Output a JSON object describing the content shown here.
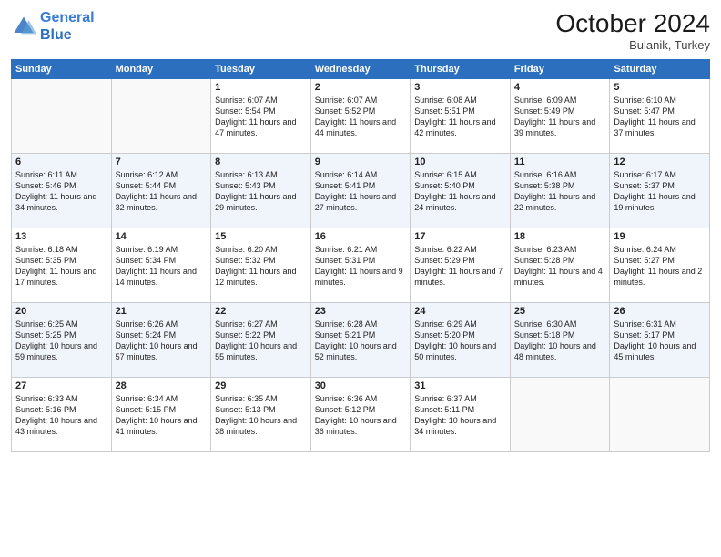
{
  "header": {
    "logo_line1": "General",
    "logo_line2": "Blue",
    "month": "October 2024",
    "location": "Bulanik, Turkey"
  },
  "days_of_week": [
    "Sunday",
    "Monday",
    "Tuesday",
    "Wednesday",
    "Thursday",
    "Friday",
    "Saturday"
  ],
  "weeks": [
    [
      {
        "day": "",
        "info": ""
      },
      {
        "day": "",
        "info": ""
      },
      {
        "day": "1",
        "info": "Sunrise: 6:07 AM\nSunset: 5:54 PM\nDaylight: 11 hours and 47 minutes."
      },
      {
        "day": "2",
        "info": "Sunrise: 6:07 AM\nSunset: 5:52 PM\nDaylight: 11 hours and 44 minutes."
      },
      {
        "day": "3",
        "info": "Sunrise: 6:08 AM\nSunset: 5:51 PM\nDaylight: 11 hours and 42 minutes."
      },
      {
        "day": "4",
        "info": "Sunrise: 6:09 AM\nSunset: 5:49 PM\nDaylight: 11 hours and 39 minutes."
      },
      {
        "day": "5",
        "info": "Sunrise: 6:10 AM\nSunset: 5:47 PM\nDaylight: 11 hours and 37 minutes."
      }
    ],
    [
      {
        "day": "6",
        "info": "Sunrise: 6:11 AM\nSunset: 5:46 PM\nDaylight: 11 hours and 34 minutes."
      },
      {
        "day": "7",
        "info": "Sunrise: 6:12 AM\nSunset: 5:44 PM\nDaylight: 11 hours and 32 minutes."
      },
      {
        "day": "8",
        "info": "Sunrise: 6:13 AM\nSunset: 5:43 PM\nDaylight: 11 hours and 29 minutes."
      },
      {
        "day": "9",
        "info": "Sunrise: 6:14 AM\nSunset: 5:41 PM\nDaylight: 11 hours and 27 minutes."
      },
      {
        "day": "10",
        "info": "Sunrise: 6:15 AM\nSunset: 5:40 PM\nDaylight: 11 hours and 24 minutes."
      },
      {
        "day": "11",
        "info": "Sunrise: 6:16 AM\nSunset: 5:38 PM\nDaylight: 11 hours and 22 minutes."
      },
      {
        "day": "12",
        "info": "Sunrise: 6:17 AM\nSunset: 5:37 PM\nDaylight: 11 hours and 19 minutes."
      }
    ],
    [
      {
        "day": "13",
        "info": "Sunrise: 6:18 AM\nSunset: 5:35 PM\nDaylight: 11 hours and 17 minutes."
      },
      {
        "day": "14",
        "info": "Sunrise: 6:19 AM\nSunset: 5:34 PM\nDaylight: 11 hours and 14 minutes."
      },
      {
        "day": "15",
        "info": "Sunrise: 6:20 AM\nSunset: 5:32 PM\nDaylight: 11 hours and 12 minutes."
      },
      {
        "day": "16",
        "info": "Sunrise: 6:21 AM\nSunset: 5:31 PM\nDaylight: 11 hours and 9 minutes."
      },
      {
        "day": "17",
        "info": "Sunrise: 6:22 AM\nSunset: 5:29 PM\nDaylight: 11 hours and 7 minutes."
      },
      {
        "day": "18",
        "info": "Sunrise: 6:23 AM\nSunset: 5:28 PM\nDaylight: 11 hours and 4 minutes."
      },
      {
        "day": "19",
        "info": "Sunrise: 6:24 AM\nSunset: 5:27 PM\nDaylight: 11 hours and 2 minutes."
      }
    ],
    [
      {
        "day": "20",
        "info": "Sunrise: 6:25 AM\nSunset: 5:25 PM\nDaylight: 10 hours and 59 minutes."
      },
      {
        "day": "21",
        "info": "Sunrise: 6:26 AM\nSunset: 5:24 PM\nDaylight: 10 hours and 57 minutes."
      },
      {
        "day": "22",
        "info": "Sunrise: 6:27 AM\nSunset: 5:22 PM\nDaylight: 10 hours and 55 minutes."
      },
      {
        "day": "23",
        "info": "Sunrise: 6:28 AM\nSunset: 5:21 PM\nDaylight: 10 hours and 52 minutes."
      },
      {
        "day": "24",
        "info": "Sunrise: 6:29 AM\nSunset: 5:20 PM\nDaylight: 10 hours and 50 minutes."
      },
      {
        "day": "25",
        "info": "Sunrise: 6:30 AM\nSunset: 5:18 PM\nDaylight: 10 hours and 48 minutes."
      },
      {
        "day": "26",
        "info": "Sunrise: 6:31 AM\nSunset: 5:17 PM\nDaylight: 10 hours and 45 minutes."
      }
    ],
    [
      {
        "day": "27",
        "info": "Sunrise: 6:33 AM\nSunset: 5:16 PM\nDaylight: 10 hours and 43 minutes."
      },
      {
        "day": "28",
        "info": "Sunrise: 6:34 AM\nSunset: 5:15 PM\nDaylight: 10 hours and 41 minutes."
      },
      {
        "day": "29",
        "info": "Sunrise: 6:35 AM\nSunset: 5:13 PM\nDaylight: 10 hours and 38 minutes."
      },
      {
        "day": "30",
        "info": "Sunrise: 6:36 AM\nSunset: 5:12 PM\nDaylight: 10 hours and 36 minutes."
      },
      {
        "day": "31",
        "info": "Sunrise: 6:37 AM\nSunset: 5:11 PM\nDaylight: 10 hours and 34 minutes."
      },
      {
        "day": "",
        "info": ""
      },
      {
        "day": "",
        "info": ""
      }
    ]
  ]
}
